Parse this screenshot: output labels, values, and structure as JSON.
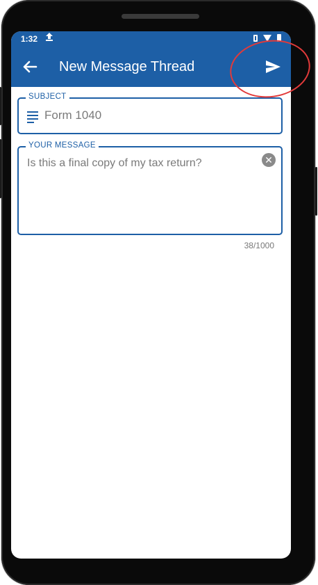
{
  "status_bar": {
    "time": "1:32",
    "upload_icon": "upload-icon"
  },
  "app_bar": {
    "title": "New Message Thread",
    "back_icon": "arrow-back-icon",
    "send_icon": "send-icon"
  },
  "subject": {
    "label": "SUBJECT",
    "value": "Form 1040"
  },
  "message": {
    "label": "YOUR MESSAGE",
    "value": "Is this a final copy of my tax return?",
    "counter": "38/1000"
  },
  "colors": {
    "primary": "#1d5fa6",
    "annotation": "#e23a3a"
  }
}
